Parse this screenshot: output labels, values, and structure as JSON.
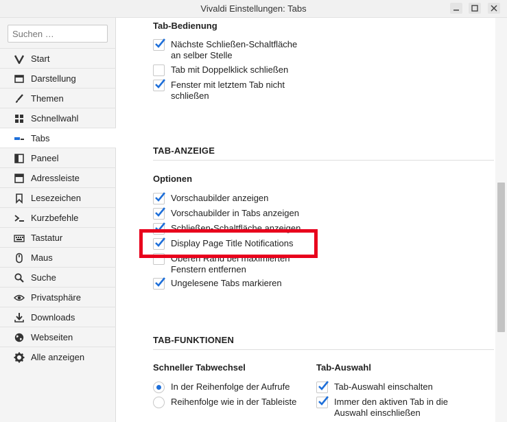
{
  "window": {
    "title": "Vivaldi Einstellungen: Tabs"
  },
  "sidebar": {
    "search_placeholder": "Suchen …",
    "items": [
      {
        "label": "Start",
        "icon": "vivaldi-logo-icon"
      },
      {
        "label": "Darstellung",
        "icon": "window-icon"
      },
      {
        "label": "Themen",
        "icon": "brush-icon"
      },
      {
        "label": "Schnellwahl",
        "icon": "grid-icon"
      },
      {
        "label": "Tabs",
        "icon": "tabs-icon",
        "active": true
      },
      {
        "label": "Paneel",
        "icon": "panel-icon"
      },
      {
        "label": "Adressleiste",
        "icon": "address-bar-icon"
      },
      {
        "label": "Lesezeichen",
        "icon": "bookmark-icon"
      },
      {
        "label": "Kurzbefehle",
        "icon": "shortcut-icon"
      },
      {
        "label": "Tastatur",
        "icon": "keyboard-icon"
      },
      {
        "label": "Maus",
        "icon": "mouse-icon"
      },
      {
        "label": "Suche",
        "icon": "magnifier-icon"
      },
      {
        "label": "Privatsphäre",
        "icon": "eye-icon"
      },
      {
        "label": "Downloads",
        "icon": "download-icon"
      },
      {
        "label": "Webseiten",
        "icon": "globe-icon"
      },
      {
        "label": "Alle anzeigen",
        "icon": "gear-icon"
      }
    ]
  },
  "tab_handling": {
    "heading": "Tab-Bedienung",
    "options": [
      {
        "line1": "Nächste Schließen-Schaltfläche",
        "line2": "an selber Stelle",
        "checked": true
      },
      {
        "line1": "Tab mit Doppelklick schließen",
        "line2": "",
        "checked": false
      },
      {
        "line1": "Fenster mit letztem Tab nicht",
        "line2": "schließen",
        "checked": true
      }
    ]
  },
  "tab_display": {
    "section": "TAB-ANZEIGE",
    "heading": "Optionen",
    "options": [
      {
        "line1": "Vorschaubilder anzeigen",
        "line2": "",
        "checked": true
      },
      {
        "line1": "Vorschaubilder in Tabs anzeigen",
        "line2": "",
        "checked": true
      },
      {
        "line1": "Schließen-Schaltfläche anzeigen",
        "line2": "",
        "checked": true
      },
      {
        "line1": "Display Page Title Notifications",
        "line2": "",
        "checked": true
      },
      {
        "line1": "Oberen Rand bei maximierten",
        "line2": "Fenstern entfernen",
        "checked": false
      },
      {
        "line1": "Ungelesene Tabs markieren",
        "line2": "",
        "checked": true
      }
    ]
  },
  "tab_functions": {
    "section": "TAB-FUNKTIONEN",
    "switch_heading": "Schneller Tabwechsel",
    "switch_options": [
      {
        "label": "In der Reihenfolge der Aufrufe",
        "selected": true
      },
      {
        "label": "Reihenfolge wie in der Tableiste",
        "selected": false
      }
    ],
    "selection_heading": "Tab-Auswahl",
    "selection_options": [
      {
        "line1": "Tab-Auswahl einschalten",
        "line2": "",
        "checked": true
      },
      {
        "line1": "Immer den aktiven Tab in die",
        "line2": "Auswahl einschließen",
        "checked": true
      }
    ]
  },
  "colors": {
    "accent": "#1e6fd9",
    "highlight_box": "#e8001c",
    "sidebar_bg": "#f4f4f4"
  }
}
